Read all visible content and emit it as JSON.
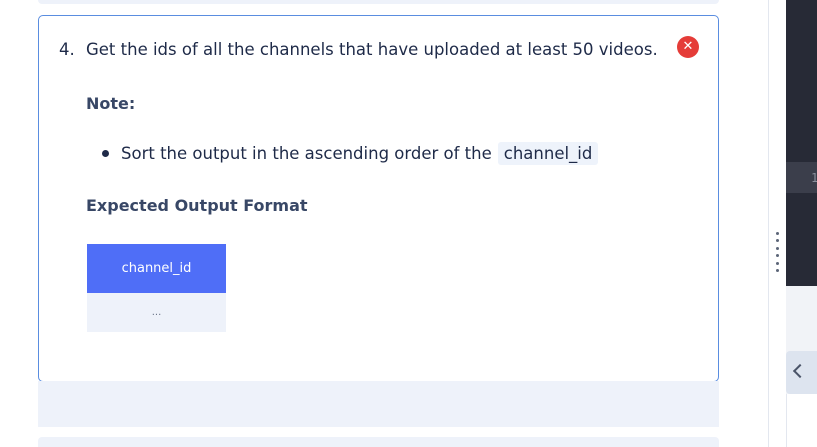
{
  "question": {
    "number": "4.",
    "text": "Get the ids of all the channels that have uploaded at least 50 videos.",
    "status_icon": "close-icon",
    "status_color": "#e53c38"
  },
  "note": {
    "heading": "Note:",
    "items": [
      {
        "text": "Sort the output in the ascending order of the",
        "code": "channel_id"
      }
    ]
  },
  "expected_output": {
    "heading": "Expected Output Format",
    "columns": [
      "channel_id"
    ],
    "rows": [
      [
        "..."
      ]
    ],
    "header_color": "#4f6ef7"
  },
  "editor": {
    "line_number": "1"
  },
  "colors": {
    "card_border": "#5a8de0",
    "text": "#1e2a48",
    "editor_bg": "#272a36"
  }
}
